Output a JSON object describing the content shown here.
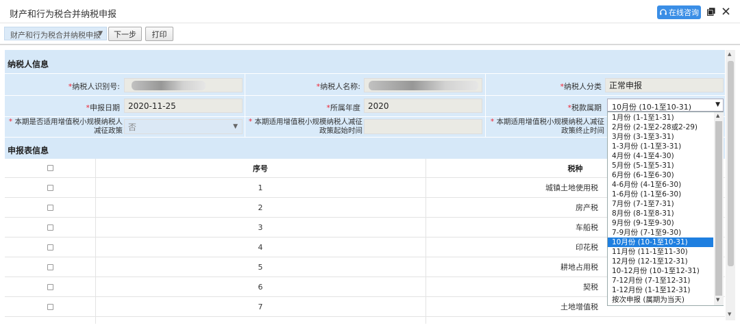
{
  "window": {
    "title": "财产和行为税合并纳税申报",
    "consult_label": "在线咨询"
  },
  "toolbar": {
    "select_value": "财产和行为税合并纳税申报",
    "next_label": "下一步",
    "print_label": "打印"
  },
  "taxpayer": {
    "section_title": "纳税人信息",
    "id_label": "纳税人识别号:",
    "name_label": "纳税人名称:",
    "category_label": "纳税人分类",
    "category_value": "正常申报",
    "date_label": "申报日期",
    "date_value": "2020-11-25",
    "year_label": "所属年度",
    "year_value": "2020",
    "period_label": "税款属期",
    "reduction_label_line1": "本期是否适用增值税小规模纳税人",
    "reduction_label_line2": "减征政策",
    "reduction_value": "否",
    "start_label_line1": "本期适用增值税小规模纳税人减征",
    "start_label_line2": "政策起始时间",
    "end_label_line1": "本期适用增值税小规模纳税人减征",
    "end_label_line2": "政策终止时间",
    "required_mark": "*"
  },
  "declaration": {
    "section_title": "申报表信息",
    "columns": {
      "seq": "序号",
      "tax": "税种"
    },
    "rows": [
      {
        "seq": "1",
        "tax": "城镇土地使用税"
      },
      {
        "seq": "2",
        "tax": "房产税"
      },
      {
        "seq": "3",
        "tax": "车船税"
      },
      {
        "seq": "4",
        "tax": "印花税"
      },
      {
        "seq": "5",
        "tax": "耕地占用税"
      },
      {
        "seq": "6",
        "tax": "契税"
      },
      {
        "seq": "7",
        "tax": "土地增值税"
      }
    ]
  },
  "period_dropdown": {
    "selected": "10月份 (10-1至10-31)",
    "options": [
      "1月份 (1-1至1-31)",
      "2月份 (2-1至2-28或2-29)",
      "3月份 (3-1至3-31)",
      "1-3月份 (1-1至3-31)",
      "4月份 (4-1至4-30)",
      "5月份 (5-1至5-31)",
      "6月份 (6-1至6-30)",
      "4-6月份 (4-1至6-30)",
      "1-6月份 (1-1至6-30)",
      "7月份 (7-1至7-31)",
      "8月份 (8-1至8-31)",
      "9月份 (9-1至9-30)",
      "7-9月份 (7-1至9-30)",
      "10月份 (10-1至10-31)",
      "11月份 (11-1至11-30)",
      "12月份 (12-1至12-31)",
      "10-12月份 (10-1至12-31)",
      "7-12月份 (7-1至12-31)",
      "1-12月份 (1-1至12-31)",
      "按次申报 (属期为当天)"
    ],
    "selected_index": 13
  },
  "colors": {
    "accent": "#3a8ee6",
    "selected_option": "#1e7fe0",
    "section_bg": "#d6e8f8",
    "required": "#e22233"
  }
}
